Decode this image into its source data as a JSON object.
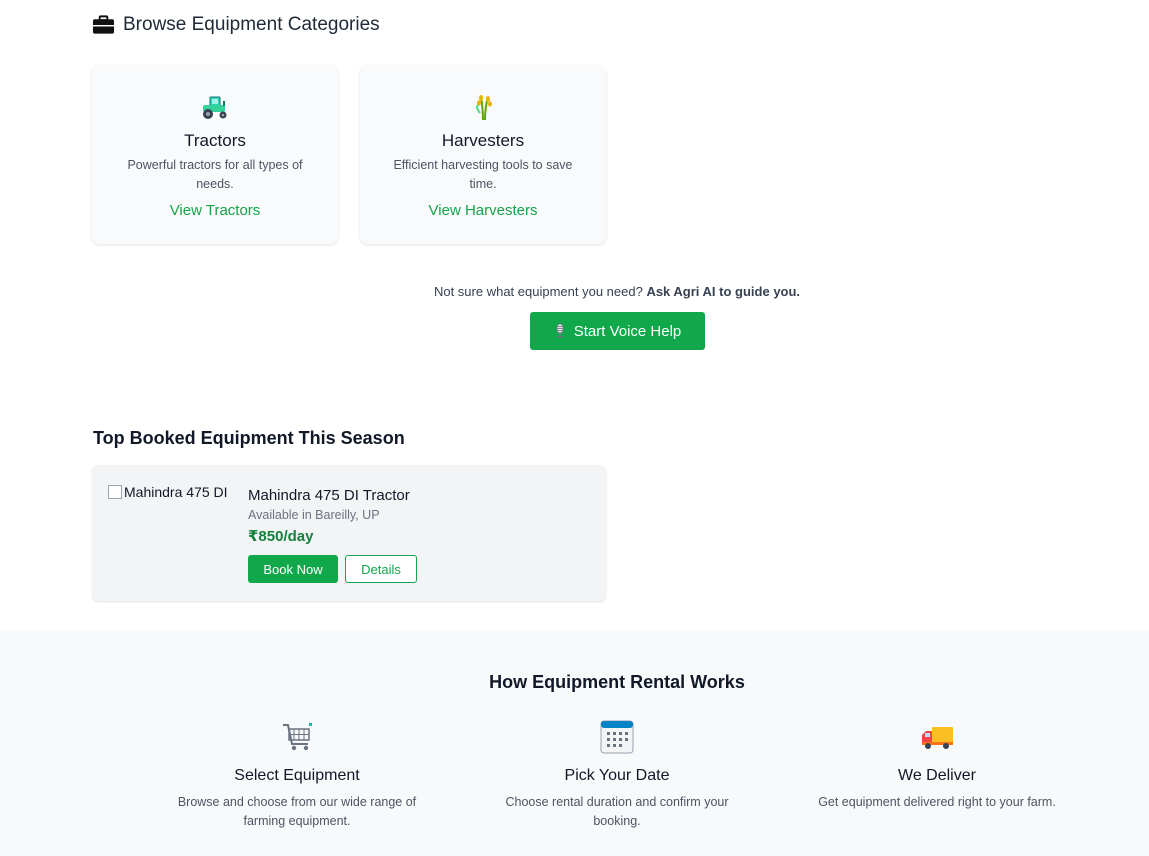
{
  "categories_section": {
    "title": "Browse Equipment Categories",
    "icon": "briefcase-icon"
  },
  "categories": [
    {
      "name": "Tractors",
      "description": "Powerful tractors for all types of needs.",
      "link": "View Tractors",
      "icon": "tractor-icon"
    },
    {
      "name": "Harvesters",
      "description": "Efficient harvesting tools to save time.",
      "link": "View Harvesters",
      "icon": "wheat-icon"
    }
  ],
  "voice_help": {
    "prompt": "Not sure what equipment you need?",
    "prompt_bold": "Ask Agri AI to guide you.",
    "button": "Start Voice Help",
    "icon": "microphone-icon"
  },
  "top_booked": {
    "title": "Top Booked Equipment This Season",
    "item": {
      "image_alt": "Mahindra 475 DI",
      "name": "Mahindra 475 DI Tractor",
      "location": "Available in Bareilly, UP",
      "price": "₹850/day",
      "book_label": "Book Now",
      "details_label": "Details"
    }
  },
  "how_it_works": {
    "title": "How Equipment Rental Works",
    "steps": [
      {
        "title": "Select Equipment",
        "description": "Browse and choose from our wide range of farming equipment.",
        "icon": "shopping-cart-icon"
      },
      {
        "title": "Pick Your Date",
        "description": "Choose rental duration and confirm your booking.",
        "icon": "calendar-icon"
      },
      {
        "title": "We Deliver",
        "description": "Get equipment delivered right to your farm.",
        "icon": "delivery-truck-icon"
      }
    ]
  },
  "colors": {
    "accent": "#10a84a",
    "price": "#15803d",
    "link": "#16a34a"
  }
}
